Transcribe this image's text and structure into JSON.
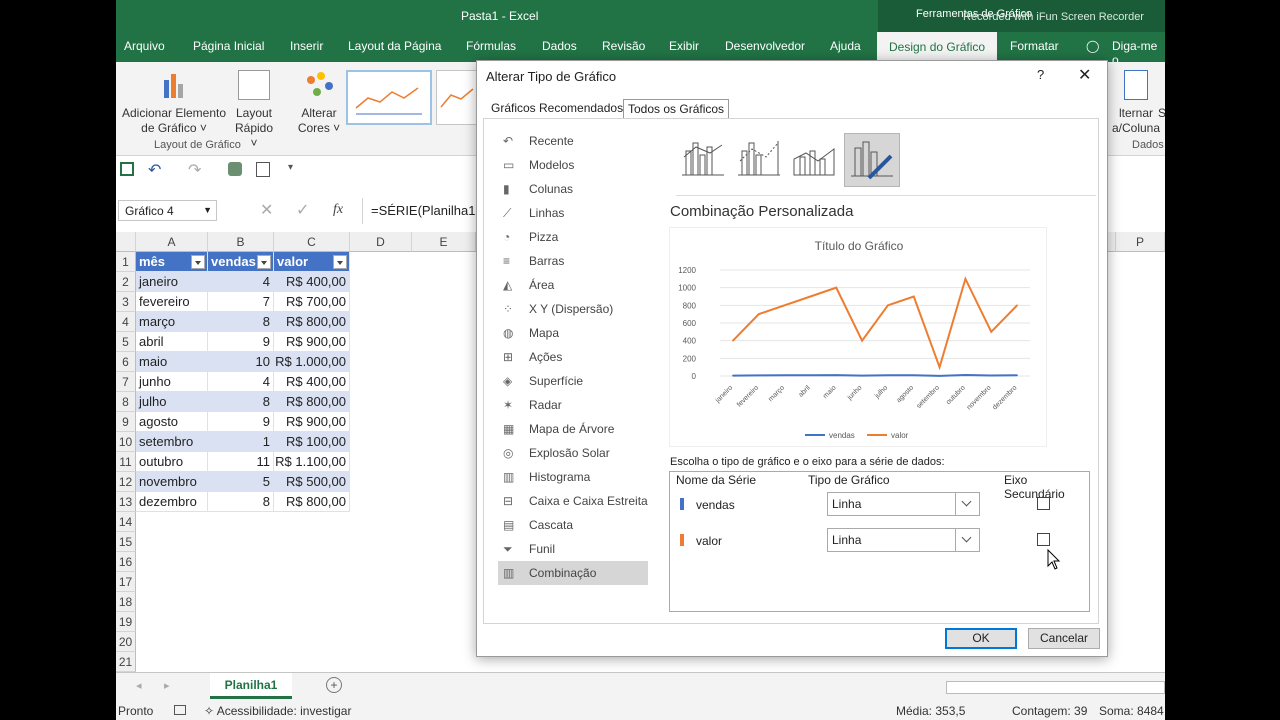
{
  "window": {
    "doc_title": "Pasta1  -  Excel",
    "context_tools": "Ferramentas de Gráfico",
    "recorder": "Recorded with iFun Screen Recorder"
  },
  "tabs": [
    "Arquivo",
    "Página Inicial",
    "Inserir",
    "Layout da Página",
    "Fórmulas",
    "Dados",
    "Revisão",
    "Exibir",
    "Desenvolvedor",
    "Ajuda",
    "Design do Gráfico",
    "Formatar",
    "Diga-me o"
  ],
  "ribbon": {
    "add_element": "Adicionar Elemento",
    "add_element2": "de Gráfico",
    "quick_layout": "Layout",
    "quick_layout2": "Rápido",
    "change_colors": "Alterar",
    "change_colors2": "Cores",
    "group_layout": "Layout de Gráfico",
    "switch1": "lternar",
    "switch2": "a/Coluna",
    "group_data": "Dados",
    "cut_s": "S"
  },
  "namebox": "Gráfico 4",
  "formula": "=SÉRIE(Planilha1!",
  "fx": "fx",
  "columns": [
    "A",
    "B",
    "C",
    "D",
    "E",
    "P"
  ],
  "table": {
    "headers": [
      "mês",
      "vendas",
      "valor"
    ],
    "rows": [
      [
        "janeiro",
        "4",
        "R$ 400,00"
      ],
      [
        "fevereiro",
        "7",
        "R$ 700,00"
      ],
      [
        "março",
        "8",
        "R$ 800,00"
      ],
      [
        "abril",
        "9",
        "R$ 900,00"
      ],
      [
        "maio",
        "10",
        "R$ 1.000,00"
      ],
      [
        "junho",
        "4",
        "R$ 400,00"
      ],
      [
        "julho",
        "8",
        "R$ 800,00"
      ],
      [
        "agosto",
        "9",
        "R$ 900,00"
      ],
      [
        "setembro",
        "1",
        "R$ 100,00"
      ],
      [
        "outubro",
        "11",
        "R$ 1.100,00"
      ],
      [
        "novembro",
        "5",
        "R$ 500,00"
      ],
      [
        "dezembro",
        "8",
        "R$ 800,00"
      ]
    ]
  },
  "row_numbers": [
    "1",
    "2",
    "3",
    "4",
    "5",
    "6",
    "7",
    "8",
    "9",
    "10",
    "11",
    "12",
    "13",
    "14",
    "15",
    "16",
    "17",
    "18",
    "19",
    "20",
    "21"
  ],
  "sheet_tab": "Planilha1",
  "status": {
    "ready": "Pronto",
    "accessibility": "Acessibilidade: investigar",
    "media": "Média: 353,5",
    "count": "Contagem: 39",
    "sum": "Soma: 8484"
  },
  "dialog": {
    "title": "Alterar Tipo de Gráfico",
    "help": "?",
    "tab_recommended": "Gráficos Recomendados",
    "tab_all": "Todos os Gráficos",
    "types": [
      "Recente",
      "Modelos",
      "Colunas",
      "Linhas",
      "Pizza",
      "Barras",
      "Área",
      "X Y (Dispersão)",
      "Mapa",
      "Ações",
      "Superfície",
      "Radar",
      "Mapa de Árvore",
      "Explosão Solar",
      "Histograma",
      "Caixa e Caixa Estreita",
      "Cascata",
      "Funil",
      "Combinação"
    ],
    "combo_title": "Combinação Personalizada",
    "series_prompt": "Escolha o tipo de gráfico e o eixo para a série de dados:",
    "col_series": "Nome da Série",
    "col_type": "Tipo de Gráfico",
    "col_axis": "Eixo Secundário",
    "series": [
      {
        "name": "vendas",
        "type": "Linha",
        "color": "#4472c4"
      },
      {
        "name": "valor",
        "type": "Linha",
        "color": "#ed7d31"
      }
    ],
    "ok": "OK",
    "cancel": "Cancelar"
  },
  "chart_data": {
    "type": "line",
    "title": "Título do Gráfico",
    "categories": [
      "janeiro",
      "fevereiro",
      "março",
      "abril",
      "maio",
      "junho",
      "julho",
      "agosto",
      "setembro",
      "outubro",
      "novembro",
      "dezembro"
    ],
    "series": [
      {
        "name": "vendas",
        "color": "#4472c4",
        "values": [
          4,
          7,
          8,
          9,
          10,
          4,
          8,
          9,
          1,
          11,
          5,
          8
        ]
      },
      {
        "name": "valor",
        "color": "#ed7d31",
        "values": [
          400,
          700,
          800,
          900,
          1000,
          400,
          800,
          900,
          100,
          1100,
          500,
          800
        ]
      }
    ],
    "ylim": [
      0,
      1200
    ],
    "yticks": [
      "1200",
      "1000",
      "800",
      "600",
      "400",
      "200",
      "0"
    ],
    "grid": true,
    "legend": "bottom"
  }
}
